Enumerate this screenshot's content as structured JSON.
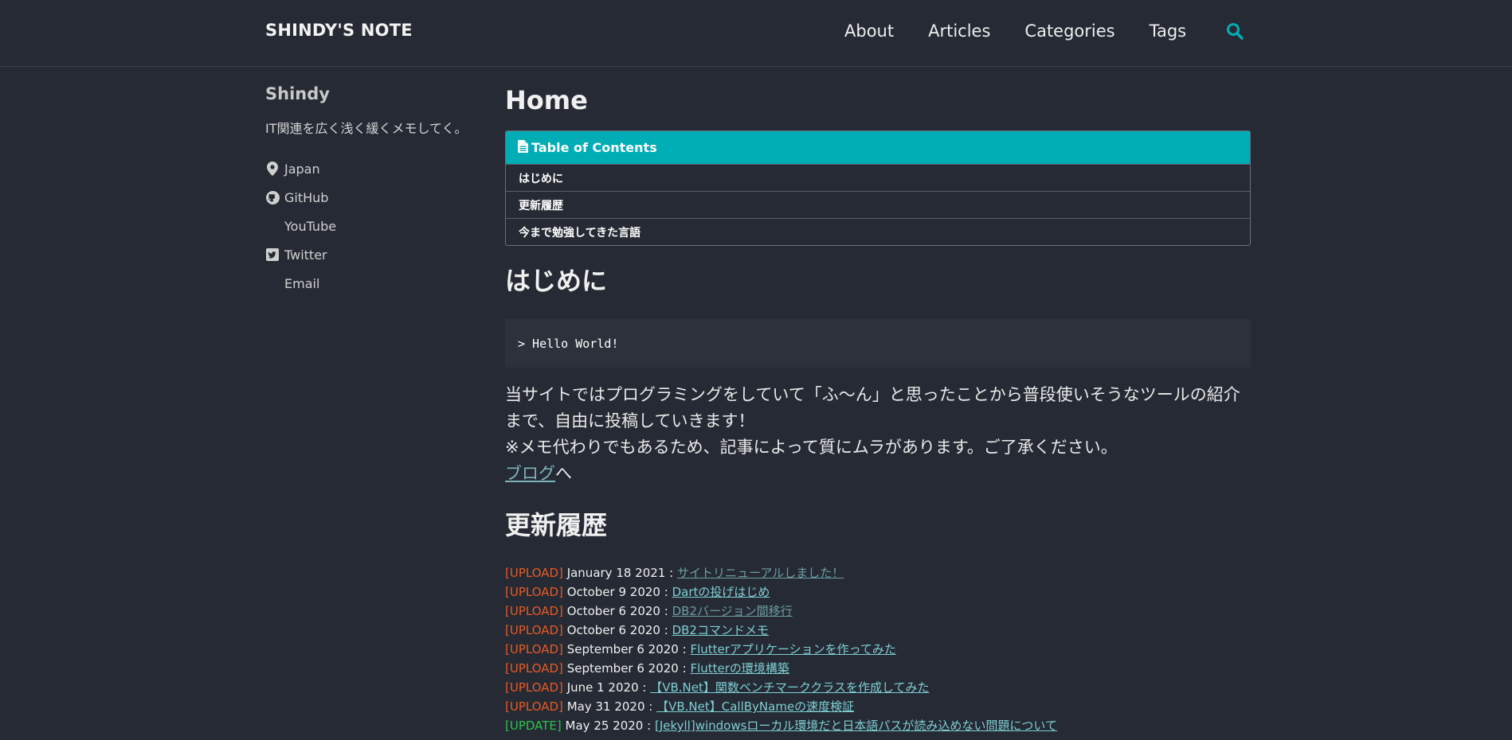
{
  "site": {
    "title": "SHINDY'S NOTE"
  },
  "nav": {
    "items": [
      "About",
      "Articles",
      "Categories",
      "Tags"
    ],
    "search_icon": "search-icon",
    "accent": "#00adb5"
  },
  "sidebar": {
    "name": "Shindy",
    "bio": "IT関連を広く浅く緩くメモしてく。",
    "links": [
      {
        "label": "Japan",
        "icon": "map-marker-icon"
      },
      {
        "label": "GitHub",
        "icon": "github-icon"
      },
      {
        "label": "YouTube",
        "icon": ""
      },
      {
        "label": "Twitter",
        "icon": "twitter-square-icon"
      },
      {
        "label": "Email",
        "icon": ""
      }
    ]
  },
  "main": {
    "title": "Home",
    "toc": {
      "header": "Table of Contents",
      "items": [
        "はじめに",
        "更新履歴",
        "今まで勉強してきた言語"
      ]
    },
    "intro": {
      "heading": "はじめに",
      "code": "> Hello World!",
      "paragraph1": "当サイトではプログラミングをしていて「ふ～ん」と思ったことから普段使いそうなツールの紹介まで、自由に投稿していきます！",
      "paragraph2": "※メモ代わりでもあるため、記事によって質にムラがあります。ご了承ください。",
      "blog_link": "ブログ",
      "blog_suffix": "へ"
    },
    "history": {
      "heading": "更新履歴",
      "entries": [
        {
          "tag": "[UPLOAD]",
          "date": "January 18 2021 :",
          "title": "サイトリニューアルしました！"
        },
        {
          "tag": "[UPLOAD]",
          "date": "October 9 2020 :",
          "title": "Dartの投げはじめ"
        },
        {
          "tag": "[UPLOAD]",
          "date": "October 6 2020 :",
          "title": "DB2バージョン間移行"
        },
        {
          "tag": "[UPLOAD]",
          "date": "October 6 2020 :",
          "title": "DB2コマンドメモ"
        },
        {
          "tag": "[UPLOAD]",
          "date": "September 6 2020 :",
          "title": "Flutterアプリケーションを作ってみた"
        },
        {
          "tag": "[UPLOAD]",
          "date": "September 6 2020 :",
          "title": "Flutterの環境構築"
        },
        {
          "tag": "[UPLOAD]",
          "date": "June 1 2020 :",
          "title": "【VB.Net】関数ベンチマーククラスを作成してみた"
        },
        {
          "tag": "[UPLOAD]",
          "date": "May 31 2020 :",
          "title": "【VB.Net】CallByNameの速度検証"
        },
        {
          "tag": "[UPDATE]",
          "date": "May 25 2020 :",
          "title": "[Jekyll]windowsローカル環境だと日本語パスが読み込めない問題について"
        }
      ]
    }
  },
  "colors": {
    "background": "#252a34",
    "upload_tag": "#e85a24",
    "update_tag": "#29c44a",
    "link": "#7ecfd4"
  }
}
